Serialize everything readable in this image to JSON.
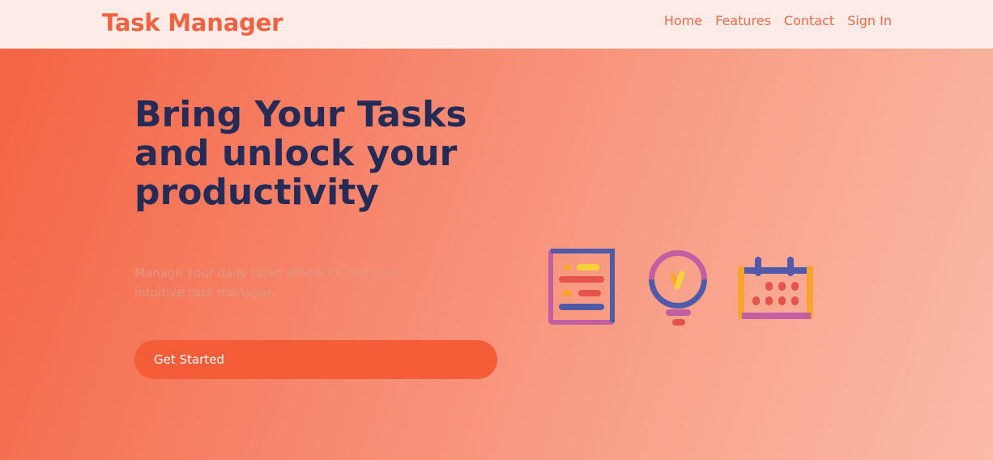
{
  "header": {
    "brand": "Task Manager",
    "nav": [
      "Home",
      "Features",
      "Contact",
      "Sign In"
    ]
  },
  "hero": {
    "headline_lines": [
      "Bring Your Tasks",
      "and unlock your",
      "productivity"
    ],
    "subtitle": "Manage your daily tasks efficiently with our intuitive task manager.",
    "cta_label": "Get Started"
  },
  "illustrations": [
    "checklist-icon",
    "lightbulb-icon",
    "calendar-icon"
  ],
  "colors": {
    "brand": "#f26141",
    "headline": "#242b57",
    "cta": "#f45d38",
    "header_bg": "#fdebe7"
  }
}
